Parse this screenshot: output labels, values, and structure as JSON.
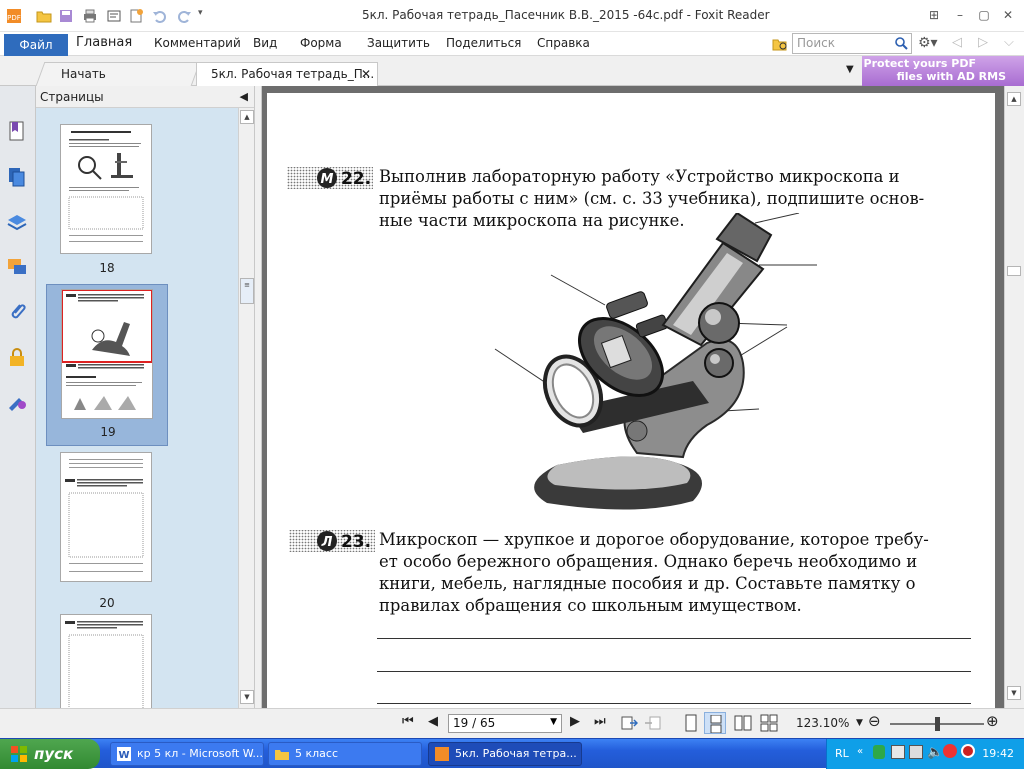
{
  "app": {
    "title": "5кл. Рабочая тетрадь_Пасечник В.В._2015 -64с.pdf - Foxit Reader"
  },
  "menu": {
    "file": "Файл",
    "items": [
      "Главная",
      "Комментарий",
      "Вид",
      "Форма",
      "Защитить",
      "Поделиться",
      "Справка"
    ]
  },
  "search": {
    "placeholder": "Поиск"
  },
  "tabs": {
    "start": "Начать",
    "doc": "5кл. Рабочая тетрадь_П..."
  },
  "ad": {
    "line1": "Protect yours PDF",
    "line2": "files with AD RMS"
  },
  "panel": {
    "title": "Страницы",
    "thumbs": [
      {
        "page": "18",
        "selected": false
      },
      {
        "page": "19",
        "selected": true
      },
      {
        "page": "20",
        "selected": false
      }
    ]
  },
  "document": {
    "task22": {
      "letter": "М",
      "num": "22.",
      "lines": [
        "Выполнив лабораторную работу «Устройство микроскопа и",
        "приёмы работы с ним» (см. с. 33 учебника), подпишите основ-",
        "ные части микроскопа на рисунке."
      ]
    },
    "task23": {
      "letter": "Л",
      "num": "23.",
      "lines": [
        "Микроскоп — хрупкое и дорогое оборудование, которое требу-",
        "ет особо бережного обращения. Однако беречь необходимо и",
        "книги, мебель, наглядные пособия и др. Составьте памятку о",
        "правилах обращения со школьным имуществом."
      ]
    }
  },
  "status": {
    "page_indicator": "19 / 65",
    "zoom": "123.10%",
    "zoom_level": 0.5
  },
  "taskbar": {
    "start": "пуск",
    "items": [
      {
        "label": "кр 5 кл - Microsoft W...",
        "icon": "word-icon"
      },
      {
        "label": "5  класс",
        "icon": "folder-icon"
      },
      {
        "label": "5кл. Рабочая тетра...",
        "icon": "foxit-icon"
      }
    ],
    "lang": "RL",
    "clock": "19:42"
  },
  "colors": {
    "accent": "#2f6cbd",
    "panel_bg": "#d3e4f1",
    "ad_purple": "#b57ad8",
    "taskbar_blue": "#245edb",
    "start_green": "#3a9a3a"
  }
}
